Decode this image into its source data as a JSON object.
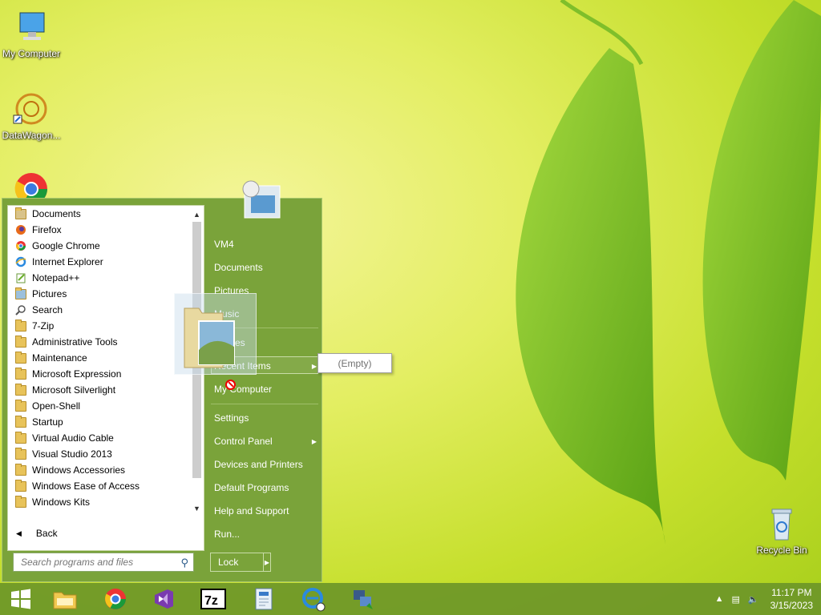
{
  "desktop": {
    "icons": [
      {
        "label": "My Computer"
      },
      {
        "label": "DataWagon..."
      },
      {
        "label": "Recycle Bin"
      }
    ]
  },
  "start_menu": {
    "programs": [
      {
        "label": "Documents",
        "icon": "documents-icon"
      },
      {
        "label": "Firefox",
        "icon": "firefox-icon"
      },
      {
        "label": "Google Chrome",
        "icon": "chrome-icon"
      },
      {
        "label": "Internet Explorer",
        "icon": "ie-icon"
      },
      {
        "label": "Notepad++",
        "icon": "notepadpp-icon"
      },
      {
        "label": "Pictures",
        "icon": "pictures-icon"
      },
      {
        "label": "Search",
        "icon": "search-icon"
      },
      {
        "label": "7-Zip",
        "icon": "folder-icon"
      },
      {
        "label": "Administrative Tools",
        "icon": "folder-icon"
      },
      {
        "label": "Maintenance",
        "icon": "folder-icon"
      },
      {
        "label": "Microsoft Expression",
        "icon": "folder-icon"
      },
      {
        "label": "Microsoft Silverlight",
        "icon": "folder-icon"
      },
      {
        "label": "Open-Shell",
        "icon": "folder-icon"
      },
      {
        "label": "Startup",
        "icon": "folder-icon"
      },
      {
        "label": "Virtual Audio Cable",
        "icon": "folder-icon"
      },
      {
        "label": "Visual Studio 2013",
        "icon": "folder-icon"
      },
      {
        "label": "Windows Accessories",
        "icon": "folder-icon"
      },
      {
        "label": "Windows Ease of Access",
        "icon": "folder-icon"
      },
      {
        "label": "Windows Kits",
        "icon": "folder-icon"
      }
    ],
    "back_label": "Back",
    "search_placeholder": "Search programs and files",
    "right_items": {
      "vm4": "VM4",
      "documents": "Documents",
      "pictures": "Pictures",
      "music": "Music",
      "games": "Games",
      "recent_items": "Recent Items",
      "my_computer": "My Computer",
      "settings": "Settings",
      "control_panel": "Control Panel",
      "devices_printers": "Devices and Printers",
      "default_programs": "Default Programs",
      "help_support": "Help and Support",
      "run": "Run..."
    },
    "lock_label": "Lock",
    "submenu_empty": "(Empty)"
  },
  "taskbar": {
    "time": "11:17 PM",
    "date": "3/15/2023"
  },
  "colors": {
    "start_menu_bg": "#7aa33a",
    "taskbar_bg": "#6c9628"
  }
}
